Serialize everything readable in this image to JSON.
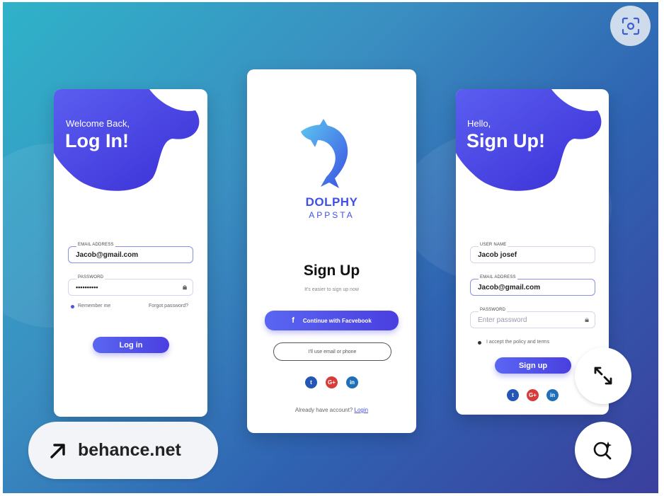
{
  "login_card": {
    "greeting": "Welcome Back,",
    "title": "Log In!",
    "email_label": "EMAIL ADDRESS",
    "email_value": "Jacob@gmail.com",
    "password_label": "PASSWORD",
    "password_value": "••••••••••",
    "remember_label": "Remember me",
    "forgot_label": "Forgot password?",
    "login_button": "Log in"
  },
  "center_card": {
    "brand_line1": "DOLPHY",
    "brand_line2": "APPSTA",
    "title": "Sign Up",
    "subtitle": "It's easier to sign up now",
    "facebook_button": "Continue with Facvebook",
    "facebook_icon": "f",
    "email_button": "I'll use email or phone",
    "bottom_text": "Already have account?",
    "bottom_link": "Login"
  },
  "signup_card": {
    "greeting": "Hello,",
    "title": "Sign Up!",
    "username_label": "USER NAME",
    "username_value": "Jacob josef",
    "email_label": "EMAIL ADDRESS",
    "email_value": "Jacob@gmail.com",
    "password_label": "PASSWORD",
    "password_placeholder": "Enter password",
    "accept_label": "I accept the policy and terms",
    "signup_button": "Sign up"
  },
  "social": {
    "twitter": "t",
    "google": "G+",
    "linkedin": "in"
  },
  "overlay": {
    "source_label": "behance.net"
  },
  "colors": {
    "accent": "#4a55e8",
    "brand": "#3e50e6"
  }
}
